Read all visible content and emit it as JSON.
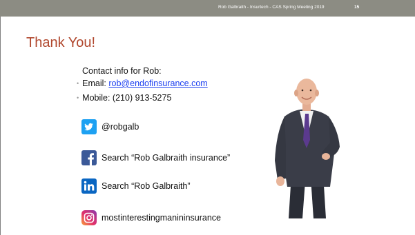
{
  "header": {
    "text": "Rob Galbraith - Insurtech - CAS Spring Meeting 2019",
    "page": "15"
  },
  "title": "Thank You!",
  "contact": {
    "heading": "Contact info for Rob:",
    "email_label": "Email:",
    "email": "rob@endofinsurance.com",
    "mobile": "Mobile: (210) 913-5275"
  },
  "social": [
    {
      "icon": "twitter-icon",
      "text": "@robgalb",
      "color": "#1da1f2"
    },
    {
      "icon": "facebook-icon",
      "text": "Search “Rob Galbraith insurance”",
      "color": "#3b5998"
    },
    {
      "icon": "linkedin-icon",
      "text": "Search “Rob Galbraith”",
      "color": "#0a66c2"
    },
    {
      "icon": "instagram-icon",
      "text": "mostinterestingmanininsurance",
      "color": "#c13584"
    }
  ],
  "colors": {
    "header_bar": "#8c8c83",
    "title": "#b0462c",
    "link": "#1a3ef0"
  }
}
